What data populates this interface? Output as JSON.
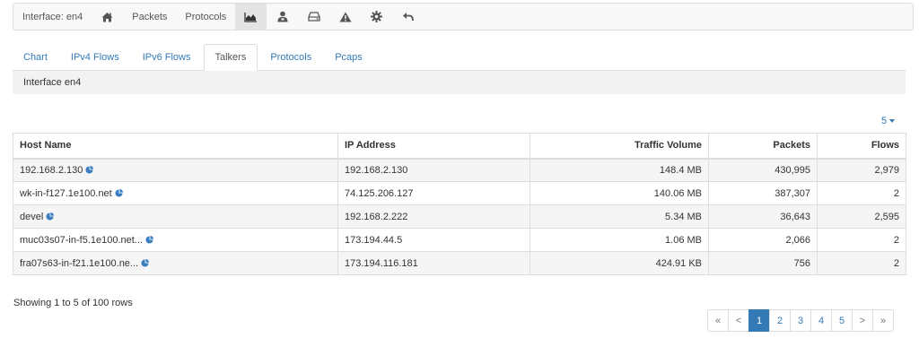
{
  "navbar": {
    "interface_label": "Interface: en4",
    "packets_label": "Packets",
    "protocols_label": "Protocols",
    "icons": [
      "home-icon",
      "area-chart-icon",
      "user-icon",
      "hard-drive-icon",
      "warning-icon",
      "gear-icon",
      "back-arrow-icon"
    ]
  },
  "tabs": [
    {
      "label": "Chart",
      "active": false
    },
    {
      "label": "IPv4 Flows",
      "active": false
    },
    {
      "label": "IPv6 Flows",
      "active": false
    },
    {
      "label": "Talkers",
      "active": true
    },
    {
      "label": "Protocols",
      "active": false
    },
    {
      "label": "Pcaps",
      "active": false
    }
  ],
  "interface_bar": {
    "text": "Interface en4"
  },
  "page_size": {
    "value": "5"
  },
  "table": {
    "headers": {
      "host": "Host Name",
      "ip": "IP Address",
      "traffic": "Traffic Volume",
      "packets": "Packets",
      "flows": "Flows"
    },
    "rows": [
      {
        "host": "192.168.2.130",
        "ip": "192.168.2.130",
        "traffic": "148.4 MB",
        "packets": "430,995",
        "flows": "2,979"
      },
      {
        "host": "wk-in-f127.1e100.net",
        "ip": "74.125.206.127",
        "traffic": "140.06 MB",
        "packets": "387,307",
        "flows": "2"
      },
      {
        "host": "devel",
        "ip": "192.168.2.222",
        "traffic": "5.34 MB",
        "packets": "36,643",
        "flows": "2,595"
      },
      {
        "host": "muc03s07-in-f5.1e100.net...",
        "ip": "173.194.44.5",
        "traffic": "1.06 MB",
        "packets": "2,066",
        "flows": "2"
      },
      {
        "host": "fra07s63-in-f21.1e100.ne...",
        "ip": "173.194.116.181",
        "traffic": "424.91 KB",
        "packets": "756",
        "flows": "2"
      }
    ]
  },
  "rows_info": "Showing 1 to 5 of 100 rows",
  "pagination": {
    "first": "«",
    "prev": "<",
    "pages": [
      "1",
      "2",
      "3",
      "4",
      "5"
    ],
    "current": "1",
    "next": ">",
    "last": "»"
  },
  "colors": {
    "link": "#337ab7",
    "active_page": "#337ab7",
    "pie_icon": "#3a7dc0"
  }
}
